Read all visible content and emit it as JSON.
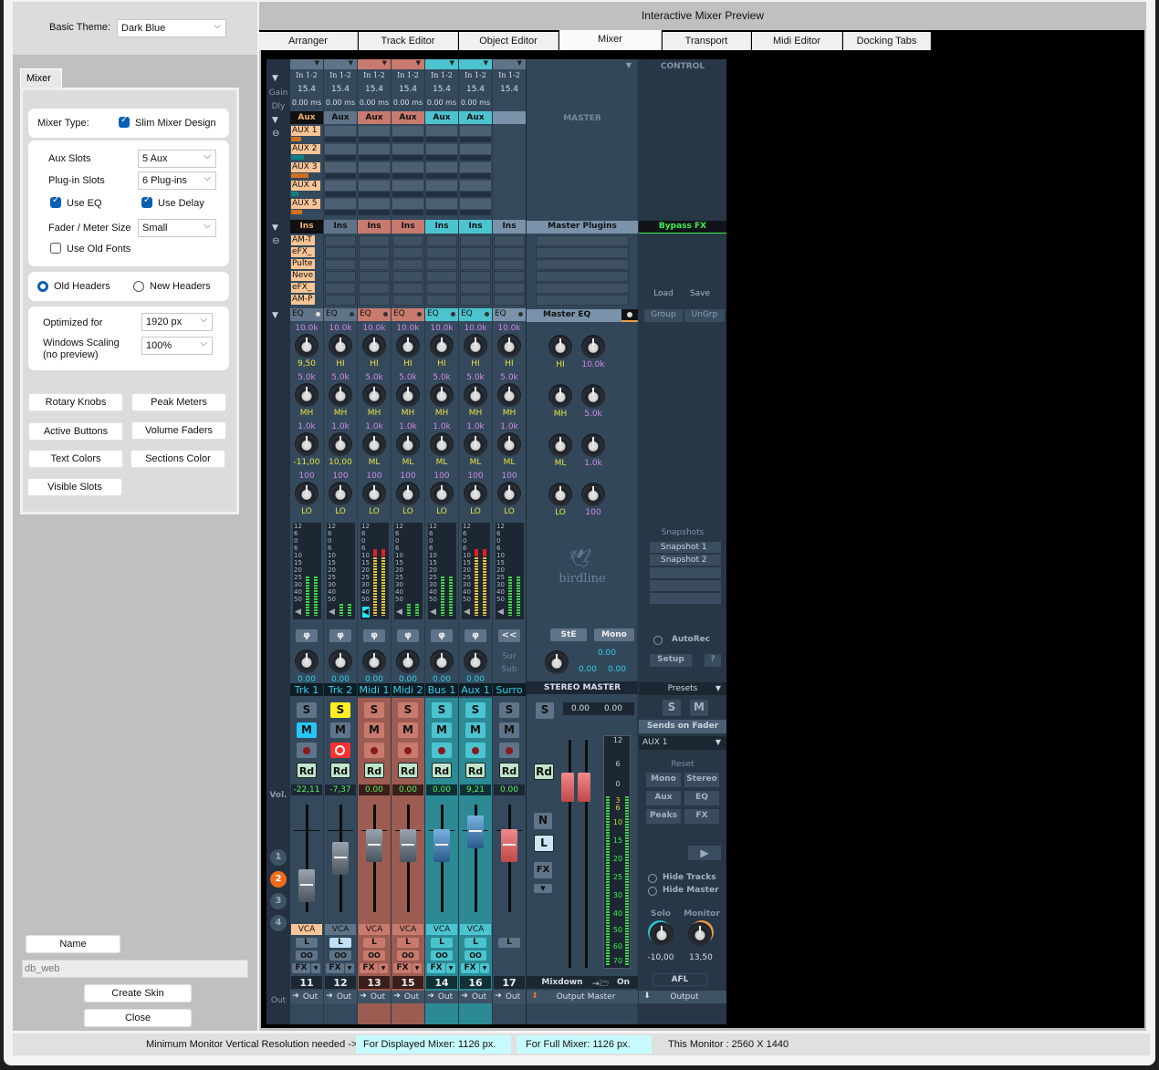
{
  "left_panel": {
    "basic_theme_label": "Basic Theme:",
    "basic_theme_value": "Dark Blue",
    "tab_label": "Mixer",
    "mixer_type_label": "Mixer Type:",
    "slim_mixer_label": "Slim Mixer Design",
    "slim_mixer_checked": true,
    "aux_slots_label": "Aux Slots",
    "aux_slots_value": "5 Aux",
    "plugin_slots_label": "Plug-in Slots",
    "plugin_slots_value": "6 Plug-ins",
    "use_eq_label": "Use EQ",
    "use_eq_checked": true,
    "use_delay_label": "Use Delay",
    "use_delay_checked": true,
    "fader_size_label": "Fader / Meter Size",
    "fader_size_value": "Small",
    "old_fonts_label": "Use Old Fonts",
    "old_fonts_checked": false,
    "old_headers_label": "Old Headers",
    "new_headers_label": "New Headers",
    "headers_selected": "Old Headers",
    "optimized_label": "Optimized for",
    "optimized_value": "1920 px",
    "scaling_label": "Windows Scaling",
    "scaling_sub": "(no preview)",
    "scaling_value": "100%",
    "buttons": [
      "Rotary Knobs",
      "Peak Meters",
      "Active Buttons",
      "Volume Faders",
      "Text Colors",
      "Sections Color",
      "Visible Slots"
    ],
    "name_button": "Name",
    "name_value": "db_web",
    "create_skin": "Create Skin",
    "close": "Close"
  },
  "preview": {
    "title": "Interactive Mixer Preview",
    "tabs": [
      "Arranger",
      "Track Editor",
      "Object Editor",
      "Mixer",
      "Transport",
      "Midi Editor",
      "Docking Tabs"
    ],
    "active_tab": "Mixer"
  },
  "mixer": {
    "row_labels": {
      "gain": "Gain",
      "dly": "Dly",
      "vol": "Vol.",
      "out": "Out"
    },
    "channels": [
      {
        "name": "Trk 1",
        "input": "In 1-2",
        "gain": "15.4",
        "delay": "0.00 ms",
        "aux": "Aux",
        "ins": "Ins",
        "hi_freq": "10.0k",
        "hi": "9,50",
        "mh_freq": "5.0k",
        "mh": "MH",
        "ml_freq": "1.0k",
        "ml": "-11,00",
        "lo_freq": "100",
        "lo": "LO",
        "pan": "0.00",
        "vol": "-22,11",
        "vca": "VCA",
        "number": "11",
        "out": "Out",
        "color": "#3b4c5e",
        "solo": false,
        "mute": true,
        "rec": false
      },
      {
        "name": "Trk 2",
        "input": "In 1-2",
        "gain": "15.4",
        "delay": "0.00 ms",
        "aux": "Aux",
        "ins": "Ins",
        "hi_freq": "10.0k",
        "hi": "HI",
        "mh_freq": "5.0k",
        "mh": "MH",
        "ml_freq": "1.0k",
        "ml": "10,00",
        "lo_freq": "100",
        "lo": "LO",
        "pan": "0.00",
        "vol": "-7,37",
        "vca": "VCA",
        "number": "12",
        "out": "Out",
        "color": "#3b4c5e",
        "solo": true,
        "mute": false,
        "rec": true
      },
      {
        "name": "Midi 1",
        "input": "In 1-2",
        "gain": "15.4",
        "delay": "0.00 ms",
        "aux": "Aux",
        "ins": "Ins",
        "hi_freq": "10.0k",
        "hi": "HI",
        "mh_freq": "5.0k",
        "mh": "MH",
        "ml_freq": "1.0k",
        "ml": "ML",
        "lo_freq": "100",
        "lo": "LO",
        "pan": "0.00",
        "vol": "0.00",
        "vca": "VCA",
        "number": "13",
        "out": "Out",
        "color": "#9c5c52",
        "solo": false,
        "mute": false,
        "rec": false
      },
      {
        "name": "Midi 2",
        "input": "In 1-2",
        "gain": "15.4",
        "delay": "0.00 ms",
        "aux": "Aux",
        "ins": "Ins",
        "hi_freq": "10.0k",
        "hi": "HI",
        "mh_freq": "5.0k",
        "mh": "MH",
        "ml_freq": "1.0k",
        "ml": "ML",
        "lo_freq": "100",
        "lo": "LO",
        "pan": "0.00",
        "vol": "0.00",
        "vca": "VCA",
        "number": "15",
        "out": "Out",
        "color": "#9c5c52",
        "solo": false,
        "mute": false,
        "rec": false
      },
      {
        "name": "Bus 1",
        "input": "In 1-2",
        "gain": "15.4",
        "delay": "0.00 ms",
        "aux": "Aux",
        "ins": "Ins",
        "hi_freq": "10.0k",
        "hi": "HI",
        "mh_freq": "5.0k",
        "mh": "MH",
        "ml_freq": "1.0k",
        "ml": "ML",
        "lo_freq": "100",
        "lo": "LO",
        "pan": "0.00",
        "vol": "0.00",
        "vca": "VCA",
        "number": "14",
        "out": "Out",
        "color": "#2c8a95",
        "solo": false,
        "mute": false,
        "rec": false
      },
      {
        "name": "Aux 1",
        "input": "In 1-2",
        "gain": "15.4",
        "delay": "0.00 ms",
        "aux": "Aux",
        "ins": "Ins",
        "hi_freq": "10.0k",
        "hi": "HI",
        "mh_freq": "5.0k",
        "mh": "MH",
        "ml_freq": "1.0k",
        "ml": "ML",
        "lo_freq": "100",
        "lo": "LO",
        "pan": "0.00",
        "vol": "9,21",
        "vca": "VCA",
        "number": "16",
        "out": "Out",
        "color": "#2c8a95",
        "solo": false,
        "mute": false,
        "rec": false
      },
      {
        "name": "Surro",
        "input": "In 1-2",
        "gain": "15.4",
        "delay": "",
        "aux": "",
        "ins": "Ins",
        "hi_freq": "10.0k",
        "hi": "HI",
        "mh_freq": "5.0k",
        "mh": "MH",
        "ml_freq": "1.0k",
        "ml": "ML",
        "lo_freq": "100",
        "lo": "LO",
        "pan": "",
        "vol": "0.00",
        "vca": "",
        "number": "17",
        "out": "Out",
        "color": "#3b4c5e",
        "solo": false,
        "mute": false,
        "rec": false
      }
    ],
    "aux_slots": [
      "AUX 1",
      "AUX 2",
      "AUX 3",
      "AUX 4",
      "AUX 5"
    ],
    "aux_send_levels": [
      0.45,
      0.6,
      0.8,
      0.35,
      0.5
    ],
    "plugins": [
      "AM-T",
      "eFX_",
      "Pulte",
      "Neve",
      "eFX_",
      "AM-P"
    ],
    "meter_scale": [
      "12",
      "6",
      "0",
      "6",
      "10",
      "15",
      "20",
      "25",
      "30",
      "40",
      "50"
    ],
    "fader_levels": [
      0.25,
      0.5,
      0.62,
      0.62,
      0.62,
      0.75,
      0.62
    ],
    "meter_levels": [
      0.5,
      0.15,
      0.85,
      0.15,
      0.5,
      0.85,
      0.5
    ],
    "vca_groups": [
      "1",
      "2",
      "3",
      "4"
    ],
    "active_vca_group": "2",
    "phase": "φ",
    "surround_back": "<<",
    "sur": "Sur",
    "sub": "Sub",
    "solo": "S",
    "mute": "M",
    "read": "Rd",
    "link": "L",
    "stereo_link": "OO",
    "fx": "FX"
  },
  "master": {
    "header": "MASTER",
    "plugins_header": "Master Plugins",
    "eq_header": "Master EQ",
    "eq_labels": [
      "HI",
      "MH",
      "ML",
      "LO"
    ],
    "eq_freqs": [
      "10.0k",
      "5.0k",
      "1.0k",
      "100"
    ],
    "logo": "birdline",
    "ste": "StE",
    "mono": "Mono",
    "pan_values": [
      "0.00",
      "0.00",
      "0.00"
    ],
    "title": "STEREO MASTER",
    "solo": "S",
    "levels": [
      "0.00",
      "0.00"
    ],
    "read": "Rd",
    "n": "N",
    "l": "L",
    "fx": "FX",
    "meter_scale": [
      "12",
      "6",
      "0",
      "3",
      "6",
      "10",
      "15",
      "20",
      "25",
      "30",
      "40",
      "50",
      "60",
      "70"
    ],
    "mixdown": "Mixdown",
    "mixdown_state": "On",
    "output": "Output Master"
  },
  "control": {
    "header": "CONTROL",
    "bypass_fx": "Bypass FX",
    "load": "Load",
    "save": "Save",
    "group": "Group",
    "ungroup": "UnGrp",
    "snapshots_label": "Snapshots",
    "snapshots": [
      "Snapshot 1",
      "Snapshot 2",
      "",
      "",
      ""
    ],
    "autorec": "AutoRec",
    "setup": "Setup",
    "help": "?",
    "presets": "Presets",
    "solo": "S",
    "mute": "M",
    "sends_on_fader": "Sends on Fader",
    "sends_target": "AUX 1",
    "reset": "Reset",
    "reset_buttons": [
      "Mono",
      "Stereo",
      "Aux",
      "EQ",
      "Peaks",
      "FX"
    ],
    "hide_tracks": "Hide Tracks",
    "hide_master": "Hide Master",
    "solo_label": "Solo",
    "monitor_label": "Monitor",
    "solo_value": "-10,00",
    "monitor_value": "13,50",
    "afl": "AFL",
    "output": "Output"
  },
  "status": {
    "label": "Minimum Monitor Vertical Resolution needed ->",
    "displayed": "For Displayed Mixer: 1126 px.",
    "full": "For Full Mixer: 1126 px.",
    "monitor": "This Monitor : 2560 X 1440"
  }
}
